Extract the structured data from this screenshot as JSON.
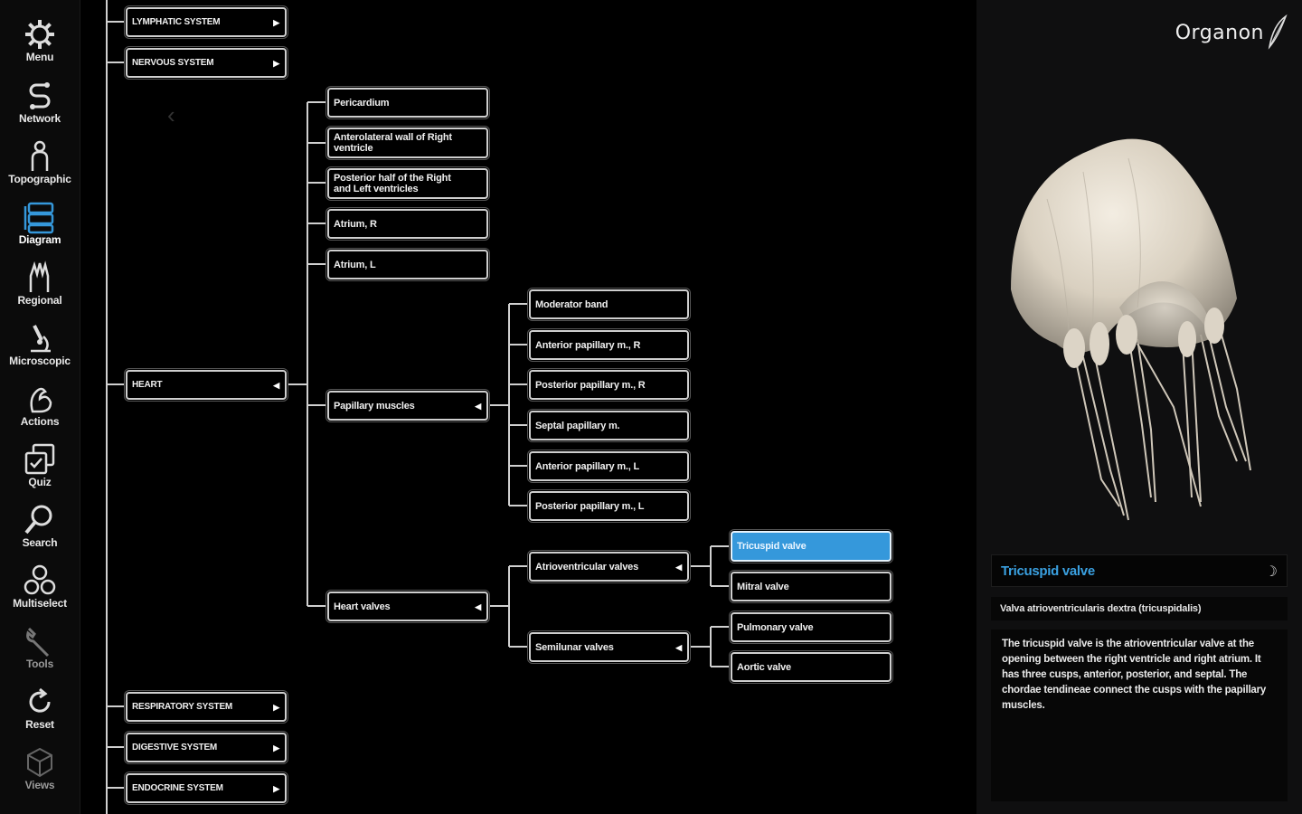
{
  "sidebar": {
    "items": [
      {
        "label": "Menu",
        "icon": "gear-icon"
      },
      {
        "label": "Network",
        "icon": "network-icon"
      },
      {
        "label": "Topographic",
        "icon": "topographic-icon"
      },
      {
        "label": "Diagram",
        "icon": "diagram-icon",
        "active": true
      },
      {
        "label": "Regional",
        "icon": "regional-icon"
      },
      {
        "label": "Microscopic",
        "icon": "microscope-icon"
      },
      {
        "label": "Actions",
        "icon": "arm-muscle-icon"
      },
      {
        "label": "Quiz",
        "icon": "quiz-icon"
      },
      {
        "label": "Search",
        "icon": "search-icon"
      },
      {
        "label": "Multiselect",
        "icon": "multiselect-icon"
      },
      {
        "label": "Tools",
        "icon": "wrench-icon"
      },
      {
        "label": "Reset",
        "icon": "reset-icon"
      },
      {
        "label": "Views",
        "icon": "cube-icon"
      }
    ]
  },
  "tree": {
    "systems": {
      "lymphatic": "LYMPHATIC SYSTEM",
      "nervous": "NERVOUS SYSTEM",
      "heart": "HEART",
      "respiratory": "RESPIRATORY SYSTEM",
      "digestive": "DIGESTIVE SYSTEM",
      "endocrine": "ENDOCRINE SYSTEM"
    },
    "heart_children": {
      "pericardium": "Pericardium",
      "anterolateral_wall": "Anterolateral wall of Right ventricle",
      "posterior_half": "Posterior half of the Right and Left ventricles",
      "atrium_r": "Atrium, R",
      "atrium_l": "Atrium, L",
      "papillary_muscles": "Papillary muscles",
      "heart_valves": "Heart valves"
    },
    "papillary_children": {
      "moderator_band": "Moderator band",
      "anterior_r": "Anterior papillary m., R",
      "posterior_r": "Posterior papillary m., R",
      "septal": "Septal papillary m.",
      "anterior_l": "Anterior papillary m., L",
      "posterior_l": "Posterior papillary m., L"
    },
    "valve_groups": {
      "atrioventricular": "Atrioventricular valves",
      "semilunar": "Semilunar valves"
    },
    "valves": {
      "tricuspid": "Tricuspid valve",
      "mitral": "Mitral valve",
      "pulmonary": "Pulmonary valve",
      "aortic": "Aortic valve"
    },
    "arrows": {
      "collapsed": "▶",
      "expanded": "◀"
    }
  },
  "panel": {
    "logo": "Organon",
    "title": "Tricuspid valve",
    "latin": "Valva atrioventricularis dextra (tricuspidalis)",
    "description": "The tricuspid valve is the atrioventricular valve at the opening between the right ventricle and right atrium. It has three cusps, anterior, posterior, and septal. The chordae tendineae connect the cusps with the papillary muscles.",
    "accent_color": "#3598db"
  }
}
